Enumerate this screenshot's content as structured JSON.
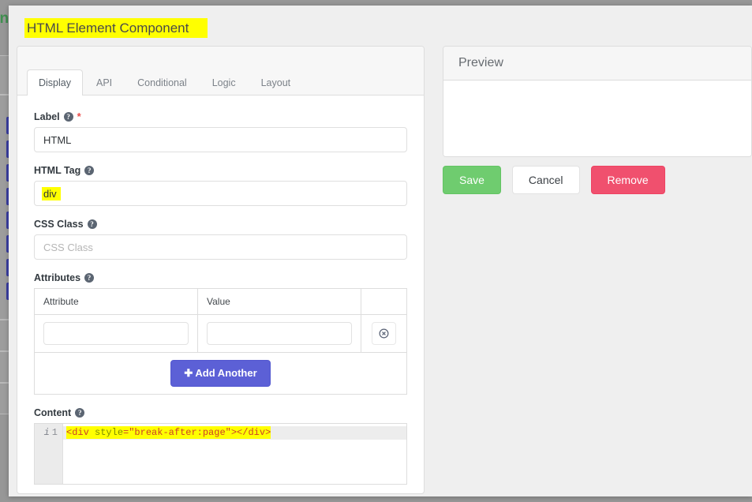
{
  "background": {
    "visible_text": "in"
  },
  "modal": {
    "title": "HTML Element Component"
  },
  "tabs": [
    {
      "label": "Display",
      "active": true
    },
    {
      "label": "API",
      "active": false
    },
    {
      "label": "Conditional",
      "active": false
    },
    {
      "label": "Logic",
      "active": false
    },
    {
      "label": "Layout",
      "active": false
    }
  ],
  "fields": {
    "label": {
      "label": "Label",
      "help_icon": "question-circle-icon",
      "required": true,
      "value": "HTML",
      "placeholder": ""
    },
    "html_tag": {
      "label": "HTML Tag",
      "help_icon": "question-circle-icon",
      "required": false,
      "value": "div",
      "highlighted": true
    },
    "css_class": {
      "label": "CSS Class",
      "help_icon": "question-circle-icon",
      "required": false,
      "value": "",
      "placeholder": "CSS Class"
    },
    "attributes": {
      "label": "Attributes",
      "help_icon": "question-circle-icon",
      "columns": [
        "Attribute",
        "Value",
        ""
      ],
      "rows": [
        {
          "attribute": "",
          "value": "",
          "remove_icon": "times-circle-icon"
        }
      ],
      "add_button": {
        "label": "Add Another",
        "icon": "plus-icon"
      }
    },
    "content": {
      "label": "Content",
      "help_icon": "question-circle-icon",
      "gutter_info_icon": "info-italic-icon",
      "line_number": "1",
      "code_tokens": [
        {
          "text": "<div",
          "type": "tag"
        },
        {
          "text": " ",
          "type": "plain"
        },
        {
          "text": "style",
          "type": "attr"
        },
        {
          "text": "=",
          "type": "plain"
        },
        {
          "text": "\"break-after:page\"",
          "type": "str"
        },
        {
          "text": "></div>",
          "type": "tag"
        }
      ],
      "code_text": "<div style=\"break-after:page\"></div>",
      "highlighted": true
    }
  },
  "preview": {
    "title": "Preview",
    "body": ""
  },
  "actions": {
    "save": "Save",
    "cancel": "Cancel",
    "remove": "Remove"
  },
  "colors": {
    "highlight": "#ffff00",
    "accent_primary": "#5c60d6",
    "save_green": "#6fcc6f",
    "remove_red": "#f0506e",
    "backdrop": "#979797"
  }
}
